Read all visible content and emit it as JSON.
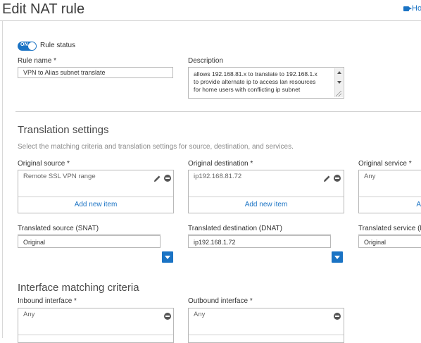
{
  "header": {
    "title": "Edit NAT rule",
    "help_label": "Ho"
  },
  "rule_status": {
    "toggle_text": "ON",
    "label": "Rule status"
  },
  "rule_name": {
    "label": "Rule name *",
    "value": "VPN to Alias subnet translate"
  },
  "description": {
    "label": "Description",
    "lines": [
      "allows 192.168.81.x to translate to 192.168.1.x",
      "to provide alternate ip to access lan resources",
      "for home users with conflicting ip subnet"
    ]
  },
  "translation": {
    "title": "Translation settings",
    "description": "Select the matching criteria and translation settings for source, destination, and services.",
    "original_source": {
      "label": "Original source *",
      "value": "Remote SSL VPN range",
      "add_label": "Add new item"
    },
    "original_destination": {
      "label": "Original destination *",
      "value": "ip192.168.81.72",
      "add_label": "Add new item"
    },
    "original_service": {
      "label": "Original service *",
      "value": "Any",
      "add_label": "A"
    },
    "translated_source": {
      "label": "Translated source (SNAT)",
      "value": "Original"
    },
    "translated_destination": {
      "label": "Translated destination (DNAT)",
      "value": "ip192.168.1.72"
    },
    "translated_service": {
      "label": "Translated service (P",
      "value": "Original"
    }
  },
  "interface": {
    "title": "Interface matching criteria",
    "inbound": {
      "label": "Inbound interface *",
      "value": "Any"
    },
    "outbound": {
      "label": "Outbound interface *",
      "value": "Any"
    }
  },
  "colors": {
    "accent": "#1a73c4",
    "border": "#b8b8b8",
    "text": "#333333"
  }
}
